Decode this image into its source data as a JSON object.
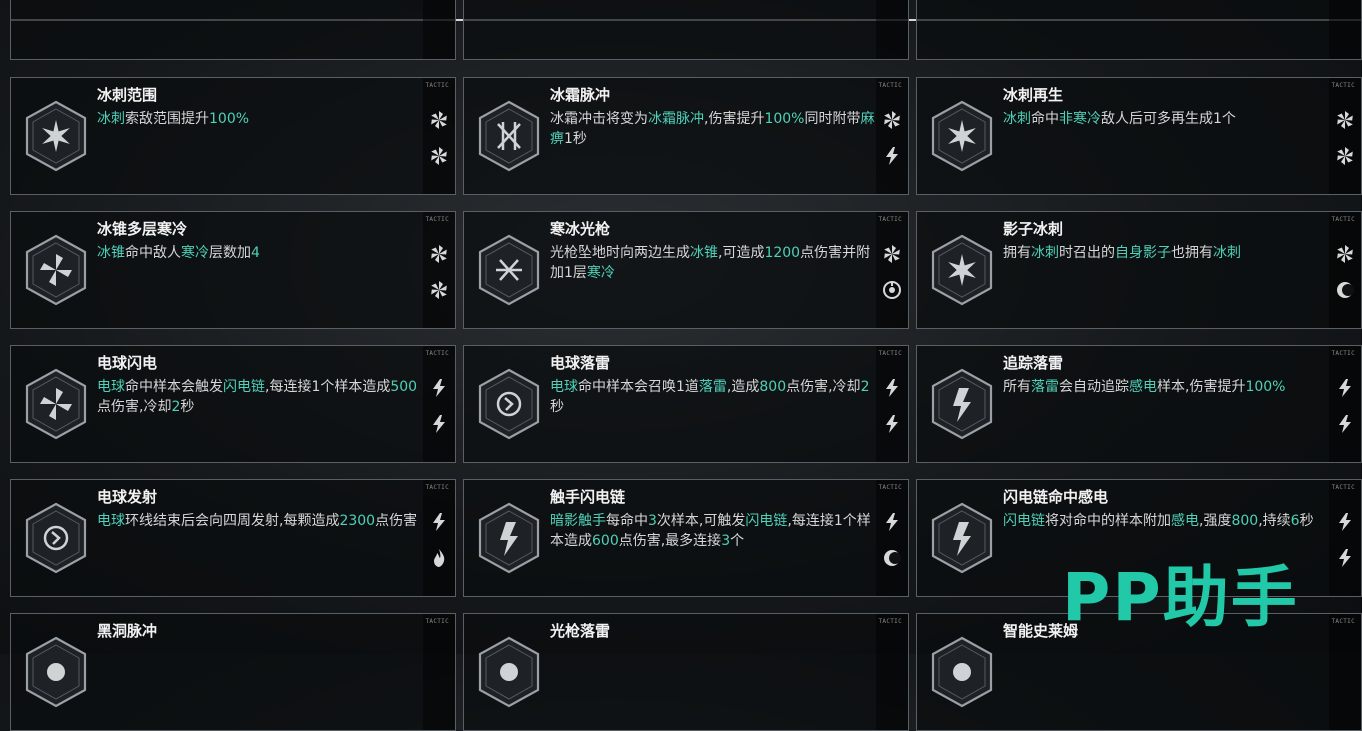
{
  "watermark": "PP助手",
  "tactic_label": "TACTIC",
  "colors": {
    "highlight": "#4fd0b8",
    "accent_logo": "#22c9a9"
  },
  "cards": [
    {
      "title": "冰刺范围",
      "desc": [
        [
          "冰刺",
          1
        ],
        [
          "索敌范围提升",
          0
        ],
        [
          "100%",
          1
        ]
      ],
      "icon": "ice-star-icon",
      "side": [
        "ice-fan-icon",
        "ice-fan-icon"
      ]
    },
    {
      "title": "冰霜脉冲",
      "desc": [
        [
          "冰霜冲击将变为",
          0
        ],
        [
          "冰霜脉冲",
          1
        ],
        [
          ",伤害提升",
          0
        ],
        [
          "100%",
          1
        ],
        [
          "同时附带",
          0
        ],
        [
          "麻痹",
          1
        ],
        [
          "1秒",
          0
        ]
      ],
      "icon": "frost-pulse-icon",
      "side": [
        "ice-fan-icon",
        "lightning-icon"
      ]
    },
    {
      "title": "冰刺再生",
      "desc": [
        [
          "冰刺",
          1
        ],
        [
          "命中",
          0
        ],
        [
          "非寒冷",
          1
        ],
        [
          "敌人后可多再生成1个",
          0
        ]
      ],
      "icon": "ice-star-icon",
      "side": [
        "ice-fan-icon",
        "ice-fan-icon"
      ]
    },
    {
      "title": "冰锥多层寒冷",
      "desc": [
        [
          "冰锥",
          1
        ],
        [
          "命中敌人",
          0
        ],
        [
          "寒冷",
          1
        ],
        [
          "层数加",
          0
        ],
        [
          "4",
          1
        ]
      ],
      "icon": "ice-spin-icon",
      "side": [
        "ice-fan-icon",
        "ice-fan-icon"
      ]
    },
    {
      "title": "寒冰光枪",
      "desc": [
        [
          "光枪坠地时向两边生成",
          0
        ],
        [
          "冰锥",
          1
        ],
        [
          ",可造成",
          0
        ],
        [
          "1200",
          1
        ],
        [
          "点伤害并附加1层",
          0
        ],
        [
          "寒冷",
          1
        ]
      ],
      "icon": "ice-lance-icon",
      "side": [
        "ice-fan-icon",
        "target-icon"
      ]
    },
    {
      "title": "影子冰刺",
      "desc": [
        [
          "拥有",
          0
        ],
        [
          "冰刺",
          1
        ],
        [
          "时召出的",
          0
        ],
        [
          "自身影子",
          1
        ],
        [
          "也拥有",
          0
        ],
        [
          "冰刺",
          1
        ]
      ],
      "icon": "ice-star-icon",
      "side": [
        "ice-fan-icon",
        "crescent-icon"
      ]
    },
    {
      "title": "电球闪电",
      "desc": [
        [
          "电球",
          1
        ],
        [
          "命中样本会触发",
          0
        ],
        [
          "闪电链",
          1
        ],
        [
          ",每连接1个样本造成",
          0
        ],
        [
          "500",
          1
        ],
        [
          "点伤害,冷却",
          0
        ],
        [
          "2",
          1
        ],
        [
          "秒",
          0
        ]
      ],
      "icon": "orb-spin-icon",
      "side": [
        "lightning-icon",
        "lightning-icon"
      ]
    },
    {
      "title": "电球落雷",
      "desc": [
        [
          "电球",
          1
        ],
        [
          "命中样本会召唤1道",
          0
        ],
        [
          "落雷",
          1
        ],
        [
          ",造成",
          0
        ],
        [
          "800",
          1
        ],
        [
          "点伤害,冷却",
          0
        ],
        [
          "2",
          1
        ],
        [
          "秒",
          0
        ]
      ],
      "icon": "orb-strike-icon",
      "side": [
        "lightning-icon",
        "lightning-icon"
      ]
    },
    {
      "title": "追踪落雷",
      "desc": [
        [
          "所有",
          0
        ],
        [
          "落雷",
          1
        ],
        [
          "会自动追踪",
          0
        ],
        [
          "感电",
          1
        ],
        [
          "样本,伤害提升",
          0
        ],
        [
          "100%",
          1
        ]
      ],
      "icon": "tracking-bolt-icon",
      "side": [
        "lightning-icon",
        "lightning-icon"
      ]
    },
    {
      "title": "电球发射",
      "desc": [
        [
          "电球",
          1
        ],
        [
          "环线结束后会向四周发射,每颗造成",
          0
        ],
        [
          "2300",
          1
        ],
        [
          "点伤害",
          0
        ]
      ],
      "icon": "orb-burst-icon",
      "side": [
        "lightning-icon",
        "flame-icon"
      ]
    },
    {
      "title": "触手闪电链",
      "desc": [
        [
          "暗影触手",
          1
        ],
        [
          "每命中",
          0
        ],
        [
          "3",
          1
        ],
        [
          "次样本,可触发",
          0
        ],
        [
          "闪电链",
          1
        ],
        [
          ",每连接1个样本造成",
          0
        ],
        [
          "600",
          1
        ],
        [
          "点伤害,最多连接",
          0
        ],
        [
          "3",
          1
        ],
        [
          "个",
          0
        ]
      ],
      "icon": "tentacle-bolt-icon",
      "side": [
        "lightning-icon",
        "crescent-icon"
      ]
    },
    {
      "title": "闪电链命中感电",
      "desc": [
        [
          "闪电链",
          1
        ],
        [
          "将对命中的样本附加",
          0
        ],
        [
          "感电",
          1
        ],
        [
          ",强度",
          0
        ],
        [
          "800",
          1
        ],
        [
          ",持续",
          0
        ],
        [
          "6",
          1
        ],
        [
          "秒",
          0
        ]
      ],
      "icon": "chain-bolt-icon",
      "side": [
        "lightning-icon",
        "lightning-icon"
      ]
    },
    {
      "title": "黑洞脉冲",
      "desc": [],
      "icon": "blackhole-icon",
      "side": []
    },
    {
      "title": "光枪落雷",
      "desc": [],
      "icon": "lance-strike-icon",
      "side": []
    },
    {
      "title": "智能史莱姆",
      "desc": [],
      "icon": "slime-icon",
      "side": []
    }
  ]
}
